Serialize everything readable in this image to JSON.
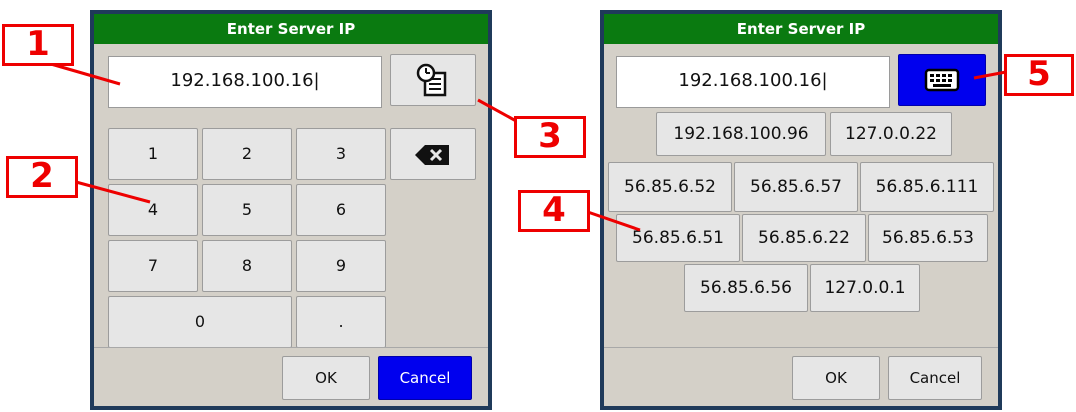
{
  "left_dialog": {
    "title": "Enter Server IP",
    "ip_value": "192.168.100.16|",
    "keys": [
      "1",
      "2",
      "3",
      "4",
      "5",
      "6",
      "7",
      "8",
      "9",
      "0",
      "."
    ],
    "ok_label": "OK",
    "cancel_label": "Cancel"
  },
  "right_dialog": {
    "title": "Enter Server IP",
    "ip_value": "192.168.100.16|",
    "recent_ips": [
      "192.168.100.96",
      "127.0.0.22",
      "56.85.6.52",
      "56.85.6.57",
      "56.85.6.111",
      "56.85.6.51",
      "56.85.6.22",
      "56.85.6.53",
      "56.85.6.56",
      "127.0.0.1"
    ],
    "ok_label": "OK",
    "cancel_label": "Cancel"
  },
  "callouts": [
    "1",
    "2",
    "3",
    "4",
    "5"
  ],
  "colors": {
    "title_green": "#0a7a10",
    "accent_blue": "#0000ee",
    "callout_red": "#ee0000"
  }
}
